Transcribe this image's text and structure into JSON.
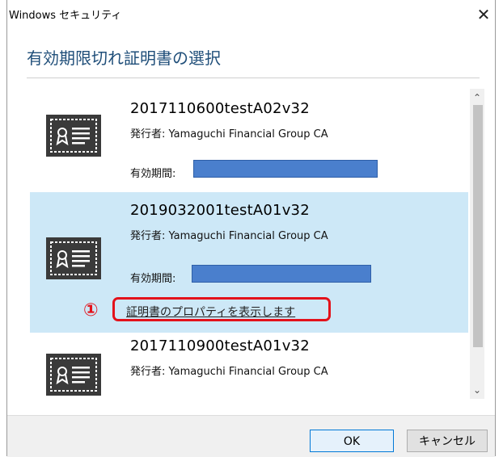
{
  "window": {
    "title": "Windows セキュリティ",
    "close_glyph": "✕"
  },
  "heading": "有効期限切れ証明書の選択",
  "certificates": [
    {
      "name": "2017110600testA02v32",
      "issuer": "発行者: Yamaguchi Financial Group CA",
      "valid_label": "有効期間:",
      "valid_value": "",
      "selected": false
    },
    {
      "name": "2019032001testA01v32",
      "issuer": "発行者: Yamaguchi Financial Group CA",
      "valid_label": "有効期間:",
      "valid_value": "",
      "selected": true,
      "properties_link": "証明書のプロパティを表示します",
      "marker": "①"
    },
    {
      "name": "2017110900testA01v32",
      "issuer": "発行者: Yamaguchi Financial Group CA",
      "selected": false
    }
  ],
  "scrollbar": {
    "up_glyph": "⌃",
    "down_glyph": "⌄"
  },
  "buttons": {
    "ok": "OK",
    "cancel": "キャンセル"
  },
  "colors": {
    "selected_bg": "#cde8f7",
    "heading": "#1f4e79",
    "highlight_red": "#e3121b",
    "redacted_blue": "#4a7fcd"
  },
  "icons": [
    "certificate-icon",
    "close-icon",
    "scroll-up-icon",
    "scroll-down-icon"
  ]
}
